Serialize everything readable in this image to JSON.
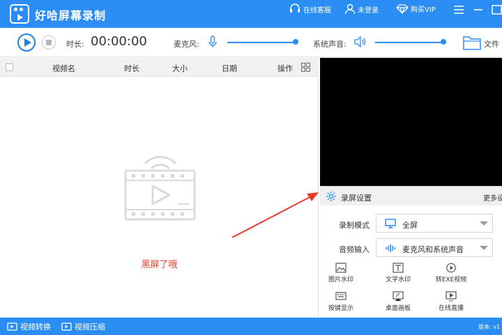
{
  "app": {
    "title": "好哈屏幕录制"
  },
  "titlebar": {
    "online_service": "在线客服",
    "not_logged_in": "未登录",
    "buy_vip": "购买VIP"
  },
  "toolbar": {
    "duration_label": "时长:",
    "timer": "00:00:00",
    "mic_label": "麦克风:",
    "mic_level": 1.0,
    "system_sound_label": "系统声音:",
    "system_sound_level": 1.0,
    "file_label": "文件"
  },
  "table": {
    "columns": [
      "视频名",
      "时长",
      "大小",
      "日期",
      "操作"
    ],
    "rows": [],
    "empty_text": "黑屏了哦"
  },
  "settings": {
    "title": "录屏设置",
    "more": "更多设",
    "record_mode": {
      "label": "录制模式",
      "value": "全屏"
    },
    "audio_input": {
      "label": "音频输入",
      "value": "麦克风和系统声音"
    },
    "tools": [
      {
        "label": "图片水印",
        "icon": "image-icon"
      },
      {
        "label": "文字水印",
        "icon": "text-icon"
      },
      {
        "label": "转EXE视频",
        "icon": "convert-icon"
      },
      {
        "label": "按键显示",
        "icon": "keyboard-icon"
      },
      {
        "label": "桌面画板",
        "icon": "drawing-board-icon"
      },
      {
        "label": "在线直播",
        "icon": "live-icon"
      }
    ]
  },
  "statusbar": {
    "video_convert": "视频转换",
    "video_compress": "视频压缩",
    "version": "版本: v1"
  },
  "colors": {
    "primary": "#2a8df3",
    "empty_text": "#e0402c",
    "preview_bg": "#000000",
    "annotation_arrow": "#e53b2c"
  }
}
